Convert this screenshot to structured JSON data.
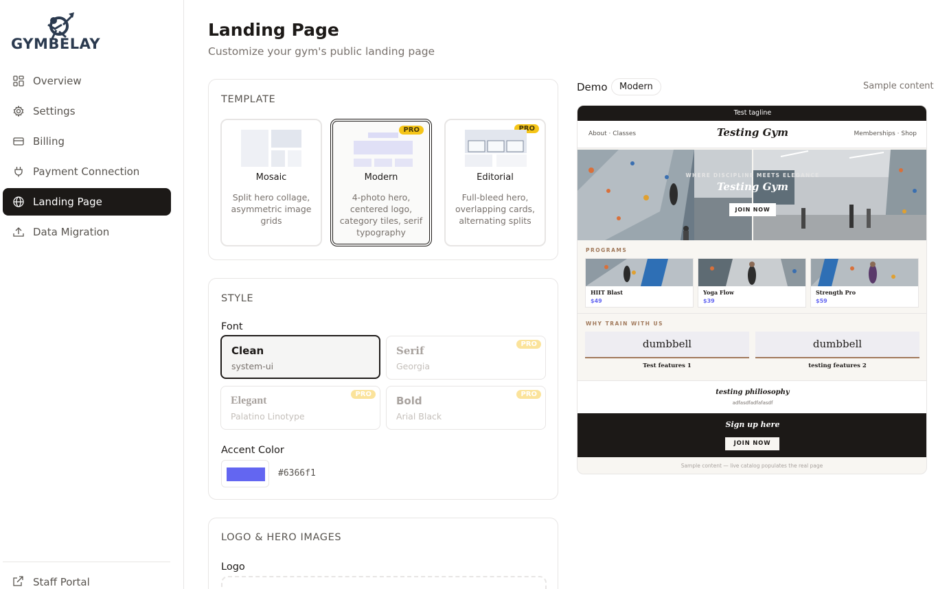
{
  "brand": {
    "name": "GYMBELAY"
  },
  "sidebar": {
    "items": [
      {
        "label": "Overview",
        "icon": "grid-icon"
      },
      {
        "label": "Settings",
        "icon": "gear-icon"
      },
      {
        "label": "Billing",
        "icon": "card-icon"
      },
      {
        "label": "Payment Connection",
        "icon": "plug-icon"
      },
      {
        "label": "Landing Page",
        "icon": "globe-icon",
        "active": true
      },
      {
        "label": "Data Migration",
        "icon": "upload-icon"
      }
    ],
    "footer_item": {
      "label": "Staff Portal",
      "icon": "external-link-icon"
    }
  },
  "page": {
    "title": "Landing Page",
    "subtitle": "Customize your gym's public landing page"
  },
  "template_section": {
    "title": "TEMPLATE",
    "options": [
      {
        "name": "Mosaic",
        "desc": "Split hero collage, asymmetric image grids",
        "pro": false,
        "selected": false
      },
      {
        "name": "Modern",
        "desc": "4-photo hero, centered logo, category tiles, serif typography",
        "pro": true,
        "selected": true
      },
      {
        "name": "Editorial",
        "desc": "Full-bleed hero, overlapping cards, alternating splits",
        "pro": true,
        "selected": false
      }
    ],
    "pro_label": "PRO"
  },
  "style_section": {
    "title": "STYLE",
    "font_label": "Font",
    "fonts": [
      {
        "name": "Clean",
        "family": "system-ui",
        "selected": true,
        "pro": false
      },
      {
        "name": "Serif",
        "family": "Georgia",
        "selected": false,
        "pro": true
      },
      {
        "name": "Elegant",
        "family": "Palatino Linotype",
        "selected": false,
        "pro": true
      },
      {
        "name": "Bold",
        "family": "Arial Black",
        "selected": false,
        "pro": true
      }
    ],
    "accent_label": "Accent Color",
    "accent_value": "#6366f1"
  },
  "images_section": {
    "title": "LOGO & HERO IMAGES",
    "logo_label": "Logo"
  },
  "demo": {
    "label": "Demo",
    "template_pill": "Modern",
    "sample_note": "Sample content",
    "preview": {
      "tagline": "Test tagline",
      "nav_left": "About · Classes",
      "gym_name": "Testing Gym",
      "nav_right": "Memberships · Shop",
      "hero_kicker": "WHERE DISCIPLINE MEETS ELEGANCE",
      "hero_title": "Testing Gym",
      "hero_button": "JOIN NOW",
      "programs_label": "PROGRAMS",
      "programs": [
        {
          "name": "HIIT Blast",
          "price": "$49"
        },
        {
          "name": "Yoga Flow",
          "price": "$39"
        },
        {
          "name": "Strength Pro",
          "price": "$59"
        }
      ],
      "why_label": "WHY TRAIN WITH US",
      "features": [
        {
          "icon": "dumbbell",
          "label": "Test features 1"
        },
        {
          "icon": "dumbbell",
          "label": "testing features 2"
        }
      ],
      "philosophy_title": "testing philiosophy",
      "philosophy_text": "adfasdfadfafasdf",
      "signup_title": "Sign up here",
      "signup_button": "JOIN NOW",
      "footnote": "Sample content — live catalog populates the real page"
    }
  },
  "colors": {
    "accent": "#6366f1",
    "dark": "#1c1917",
    "pro_badge": "#f5c518"
  }
}
